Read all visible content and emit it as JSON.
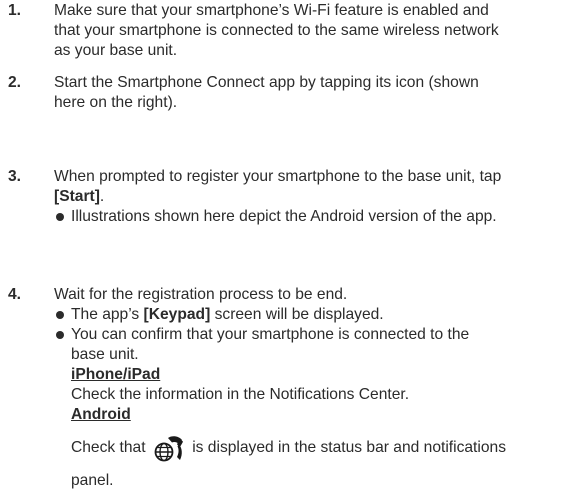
{
  "steps": [
    {
      "num": "1.",
      "lines": [
        "Make sure that your smartphone’s Wi-Fi feature is enabled and",
        "that your smartphone is connected to the same wireless network",
        "as your base unit."
      ]
    },
    {
      "num": "2.",
      "lines": [
        "Start the Smartphone Connect app by tapping its icon (shown",
        "here on the right)."
      ]
    },
    {
      "num": "3.",
      "line1": "When prompted to register your smartphone to the base unit, tap",
      "line2_bold": "[Start]",
      "line2_rest": ".",
      "bullet": "Illustrations shown here depict the Android version of the app."
    },
    {
      "num": "4.",
      "line1": "Wait for the registration process to be end.",
      "bullet1_pre": "The app’s ",
      "bullet1_bold": "[Keypad]",
      "bullet1_post": " screen will be displayed.",
      "bullet2_lines": [
        "You can confirm that your smartphone is connected to the",
        "base unit."
      ],
      "iphone_heading": "iPhone/iPad",
      "iphone_text": "Check the information in the Notifications Center.",
      "android_heading": "Android",
      "android_pre": "Check that ",
      "android_post": " is displayed in the status bar and notifications",
      "android_last": "panel.",
      "status_icon": "smartphone-connect-status-icon"
    }
  ]
}
